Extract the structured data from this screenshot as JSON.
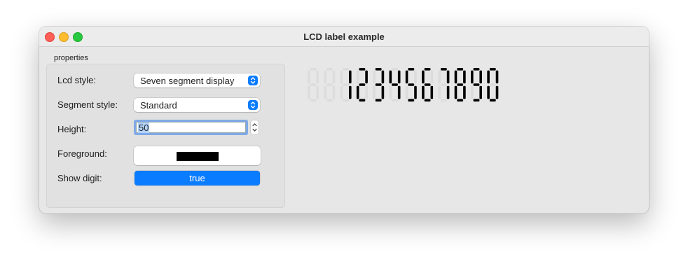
{
  "window": {
    "title": "LCD label example"
  },
  "properties": {
    "group_label": "properties",
    "lcd_style": {
      "label": "Lcd style:",
      "value": "Seven segment display"
    },
    "segment_style": {
      "label": "Segment style:",
      "value": "Standard"
    },
    "height": {
      "label": "Height:",
      "value": "50"
    },
    "foreground": {
      "label": "Foreground:",
      "color": "#000000"
    },
    "show_digit": {
      "label": "Show digit:",
      "value": "true"
    }
  },
  "lcd": {
    "text": "1234567890",
    "digits": 12,
    "on_color": "#000000",
    "off_color": "#dcdcdc"
  },
  "colors": {
    "accent": "#0a7cff",
    "window_bg": "#e7e7e7"
  }
}
